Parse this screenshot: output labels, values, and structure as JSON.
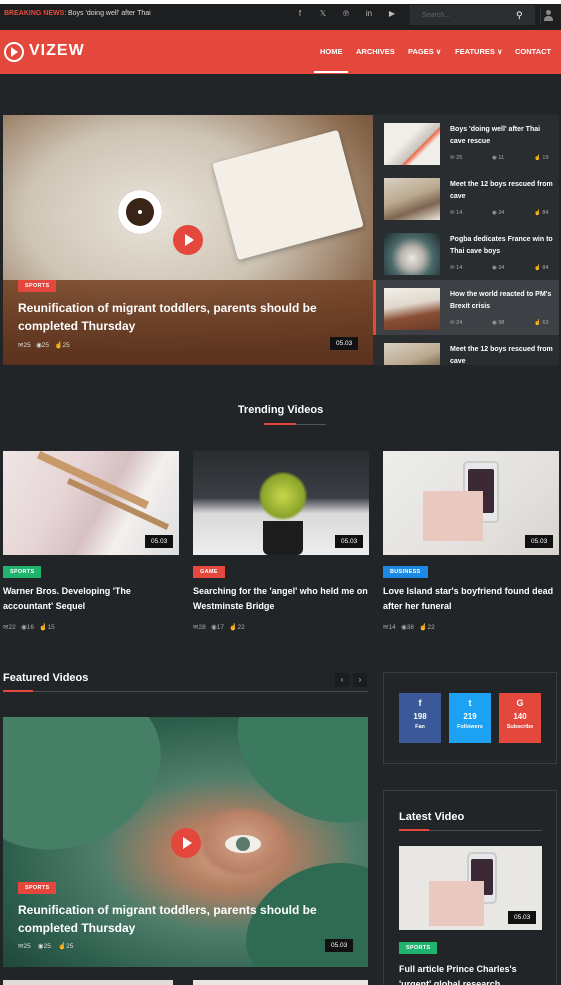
{
  "topbar": {
    "breaking_label": "BREAKING NEWS:",
    "breaking_text": "Boys 'doing well' after Thai",
    "search_placeholder": "Search..."
  },
  "nav": {
    "logo": "VIZEW",
    "items": [
      "HOME",
      "ARCHIVES",
      "PAGES ∨",
      "FEATURES ∨",
      "CONTACT"
    ]
  },
  "hero": {
    "tag": "SPORTS",
    "title": "Reunification of migrant toddlers, parents should be completed Thursday",
    "comments": "25",
    "views": "25",
    "likes": "25",
    "duration": "05.03"
  },
  "sidebar": [
    {
      "title": "Boys 'doing well' after Thai cave rescue",
      "comments": "25",
      "views": "11",
      "likes": "19"
    },
    {
      "title": "Meet the 12 boys rescued from cave",
      "comments": "14",
      "views": "34",
      "likes": "84"
    },
    {
      "title": "Pogba dedicates France win to Thai cave boys",
      "comments": "14",
      "views": "34",
      "likes": "84"
    },
    {
      "title": "How the world reacted to PM's Brexit crisis",
      "comments": "24",
      "views": "98",
      "likes": "63"
    },
    {
      "title": "Meet the 12 boys rescued from cave",
      "comments": "",
      "views": "",
      "likes": ""
    }
  ],
  "trending": {
    "heading": "Trending Videos",
    "items": [
      {
        "tag": "SPORTS",
        "title": "Warner Bros. Developing 'The accountant' Sequel",
        "comments": "22",
        "views": "16",
        "likes": "15",
        "duration": "05.03"
      },
      {
        "tag": "GAME",
        "title": "Searching for the 'angel' who held me on Westminste Bridge",
        "comments": "28",
        "views": "17",
        "likes": "22",
        "duration": "05.03"
      },
      {
        "tag": "BUSINESS",
        "title": "Love Island star's boyfriend found dead after her funeral",
        "comments": "14",
        "views": "38",
        "likes": "22",
        "duration": "05.03"
      }
    ]
  },
  "featured": {
    "heading": "Featured Videos",
    "tag": "SPORTS",
    "title": "Reunification of migrant toddlers, parents should be completed Thursday",
    "comments": "25",
    "views": "25",
    "likes": "25",
    "duration": "05.03"
  },
  "social": [
    {
      "icon": "f",
      "count": "198",
      "label": "Fan",
      "color": "#3b5998"
    },
    {
      "icon": "t",
      "count": "219",
      "label": "Followers",
      "color": "#1da1f2"
    },
    {
      "icon": "G",
      "count": "140",
      "label": "Subscribe",
      "color": "#e4473c"
    }
  ],
  "latest": {
    "heading": "Latest Video",
    "tag": "SPORTS",
    "duration": "05.03",
    "title": "Full article Prince Charles's 'urgent' global research"
  },
  "colors": {
    "accent": "#e4473c",
    "bg": "#222527",
    "sports": "#20b36e",
    "business": "#1e88e5"
  }
}
